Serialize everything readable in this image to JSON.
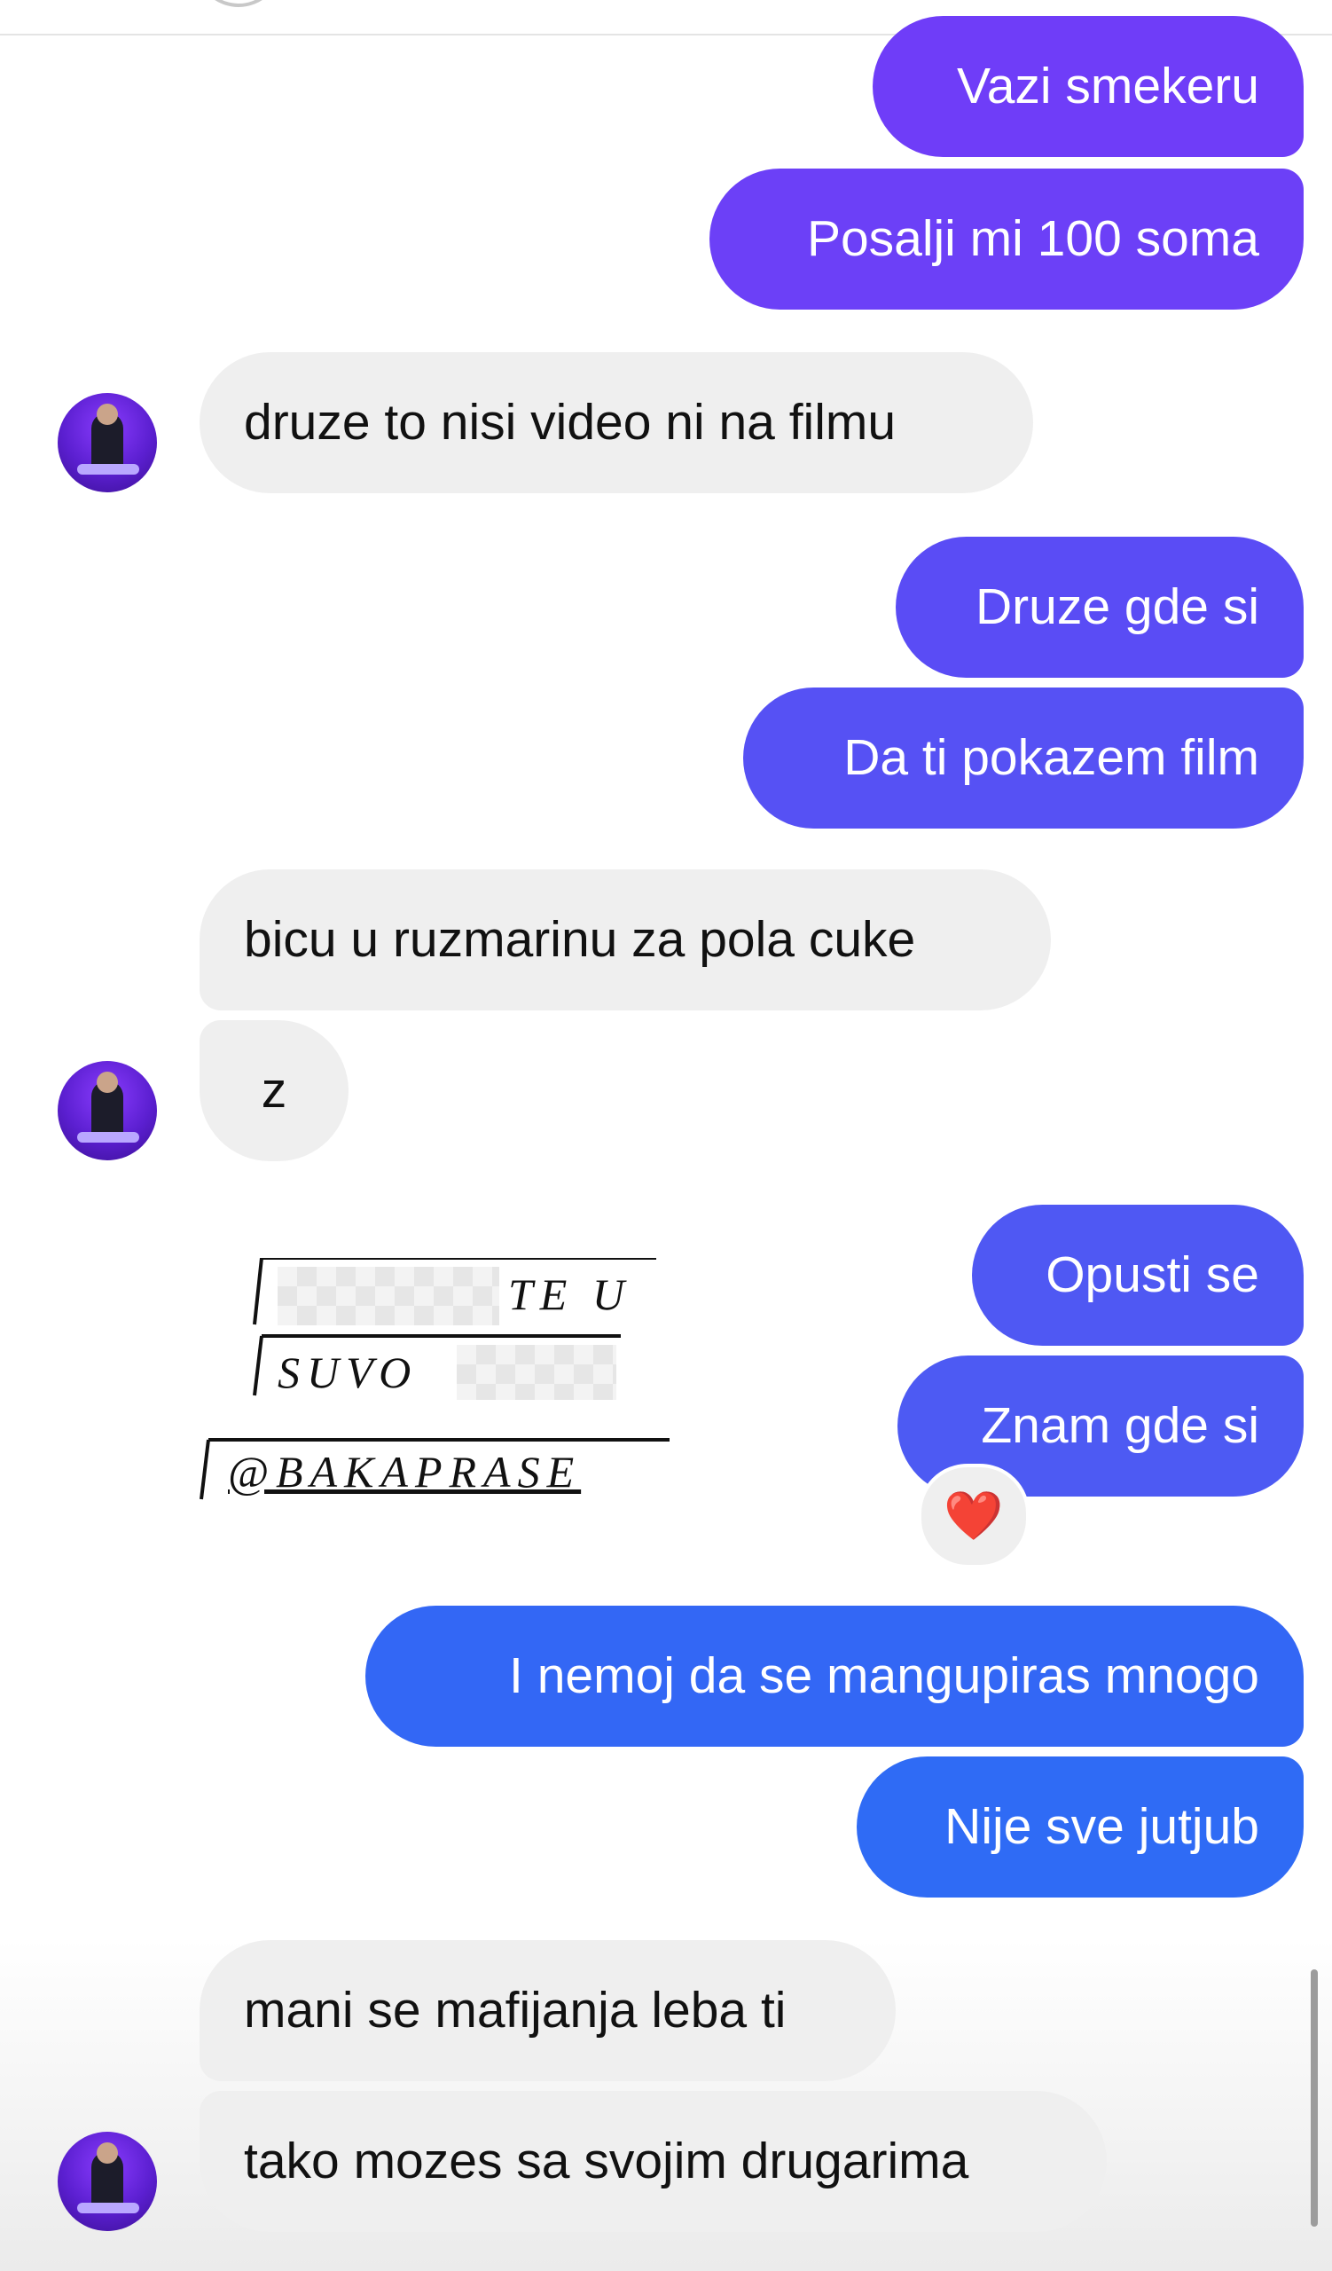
{
  "colors": {
    "outgoing_purple": "#6f3df8",
    "outgoing_indigo": "#4f58f3",
    "outgoing_blue": "#2f6bf5",
    "incoming_gray": "#efefef",
    "avatar_purple": "#6a27e8"
  },
  "messages": {
    "m1": "Vazi smekeru",
    "m2": "Posalji mi 100 soma",
    "m3": "druze to nisi video ni na filmu",
    "m4": "Druze gde si",
    "m5": "Da ti pokazem film",
    "m6": "bicu u ruzmarinu za pola cuke",
    "m7": "z",
    "m8": "Opusti se",
    "m9": "Znam gde si",
    "m10": "I nemoj da se mangupiras mnogo",
    "m11": "Nije sve jutjub",
    "m12": "mani se mafijanja leba ti",
    "m13": "tako mozes sa svojim drugarima"
  },
  "shared_story": {
    "line1": "TE U",
    "line2": "SUVO",
    "handle": "@BAKAPRASE"
  },
  "reaction": {
    "emoji": "❤️",
    "icon": "heart-icon"
  },
  "avatar": {
    "icon": "user-avatar"
  }
}
